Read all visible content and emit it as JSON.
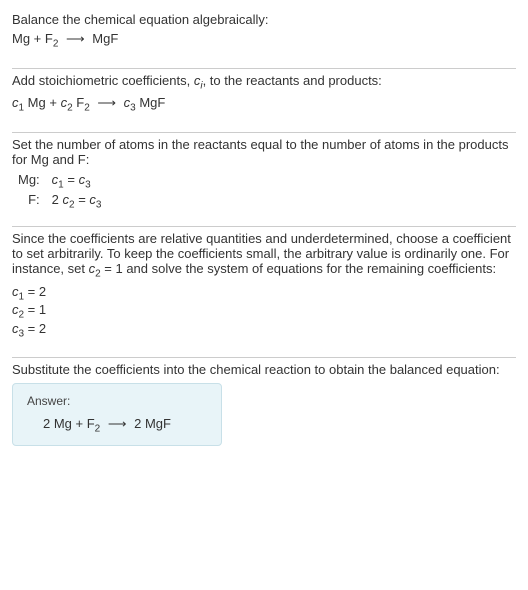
{
  "s1": {
    "line1": "Balance the chemical equation algebraically:",
    "eq_lhs1": "Mg + F",
    "eq_sub1": "2",
    "eq_arrow": "⟶",
    "eq_rhs1": "MgF"
  },
  "s2": {
    "line1_a": "Add stoichiometric coefficients, ",
    "line1_b": "c",
    "line1_sub": "i",
    "line1_c": ", to the reactants and products:",
    "c1": "c",
    "c1s": "1",
    "sp1": " Mg + ",
    "c2": "c",
    "c2s": "2",
    "sp2": " F",
    "f2s": "2",
    "arrow": "⟶",
    "c3": "c",
    "c3s": "3",
    "sp3": " MgF"
  },
  "s3": {
    "text": "Set the number of atoms in the reactants equal to the number of atoms in the products for Mg and F:",
    "r1_label": "Mg:",
    "r1_c1": "c",
    "r1_c1s": "1",
    "r1_eq": " = ",
    "r1_c3": "c",
    "r1_c3s": "3",
    "r2_label": "F:",
    "r2_two": "2 ",
    "r2_c2": "c",
    "r2_c2s": "2",
    "r2_eq": " = ",
    "r2_c3": "c",
    "r2_c3s": "3"
  },
  "s4": {
    "text_a": "Since the coefficients are relative quantities and underdetermined, choose a coefficient to set arbitrarily. To keep the coefficients small, the arbitrary value is ordinarily one. For instance, set ",
    "cset": "c",
    "csets": "2",
    "cval": " = 1",
    "text_b": " and solve the system of equations for the remaining coefficients:",
    "l1_c": "c",
    "l1_s": "1",
    "l1_v": " = 2",
    "l2_c": "c",
    "l2_s": "2",
    "l2_v": " = 1",
    "l3_c": "c",
    "l3_s": "3",
    "l3_v": " = 2"
  },
  "s5": {
    "text": "Substitute the coefficients into the chemical reaction to obtain the balanced equation:",
    "answer_label": "Answer:",
    "lhs": "2 Mg + F",
    "lhs_sub": "2",
    "arrow": "⟶",
    "rhs": "2 MgF"
  }
}
